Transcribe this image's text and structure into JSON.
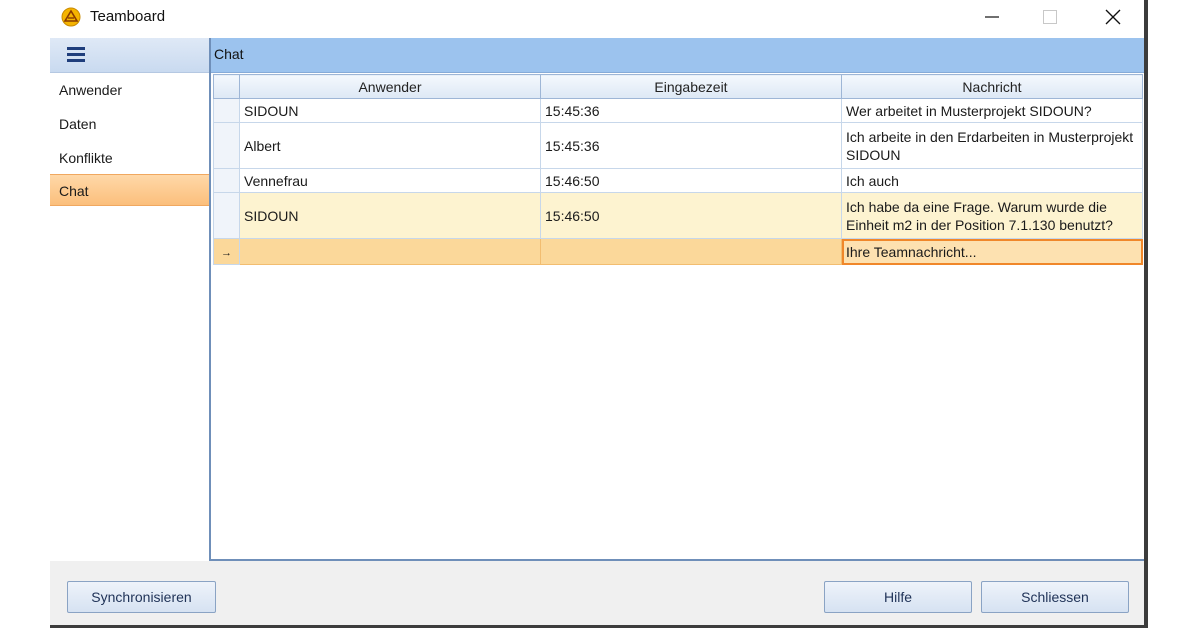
{
  "window": {
    "title": "Teamboard",
    "icon": "teamboard-logo-icon",
    "controls": [
      "minimize-icon",
      "maximize-icon",
      "close-icon"
    ]
  },
  "sidebar": {
    "menu_icon": "hamburger-menu-icon",
    "items": [
      {
        "label": "Anwender",
        "active": false
      },
      {
        "label": "Daten",
        "active": false
      },
      {
        "label": "Konflikte",
        "active": false
      },
      {
        "label": "Chat",
        "active": true
      }
    ]
  },
  "main": {
    "title": "Chat",
    "grid": {
      "columns": [
        "Anwender",
        "Eingabezeit",
        "Nachricht"
      ],
      "rows": [
        {
          "user": "SIDOUN",
          "time": "15:45:36",
          "message": "Wer arbeitet in Musterprojekt SIDOUN?"
        },
        {
          "user": "Albert",
          "time": "15:45:36",
          "message": "Ich arbeite in den Erdarbeiten in Musterprojekt SIDOUN"
        },
        {
          "user": "Vennefrau",
          "time": "15:46:50",
          "message": "Ich auch"
        },
        {
          "user": "SIDOUN",
          "time": "15:46:50",
          "message": "Ich habe da eine Frage. Warum wurde die Einheit m2 in der Position 7.1.130 benutzt?"
        }
      ],
      "new_row": {
        "indicator": "→",
        "placeholder": "Ihre Teamnachricht..."
      }
    }
  },
  "footer": {
    "sync_label": "Synchronisieren",
    "help_label": "Hilfe",
    "close_label": "Schliessen"
  },
  "colors": {
    "accent_orange": "#f0872a",
    "header_blue": "#9cc3ee",
    "selected_row": "#fdf3d0",
    "new_row": "#fbd89a"
  }
}
